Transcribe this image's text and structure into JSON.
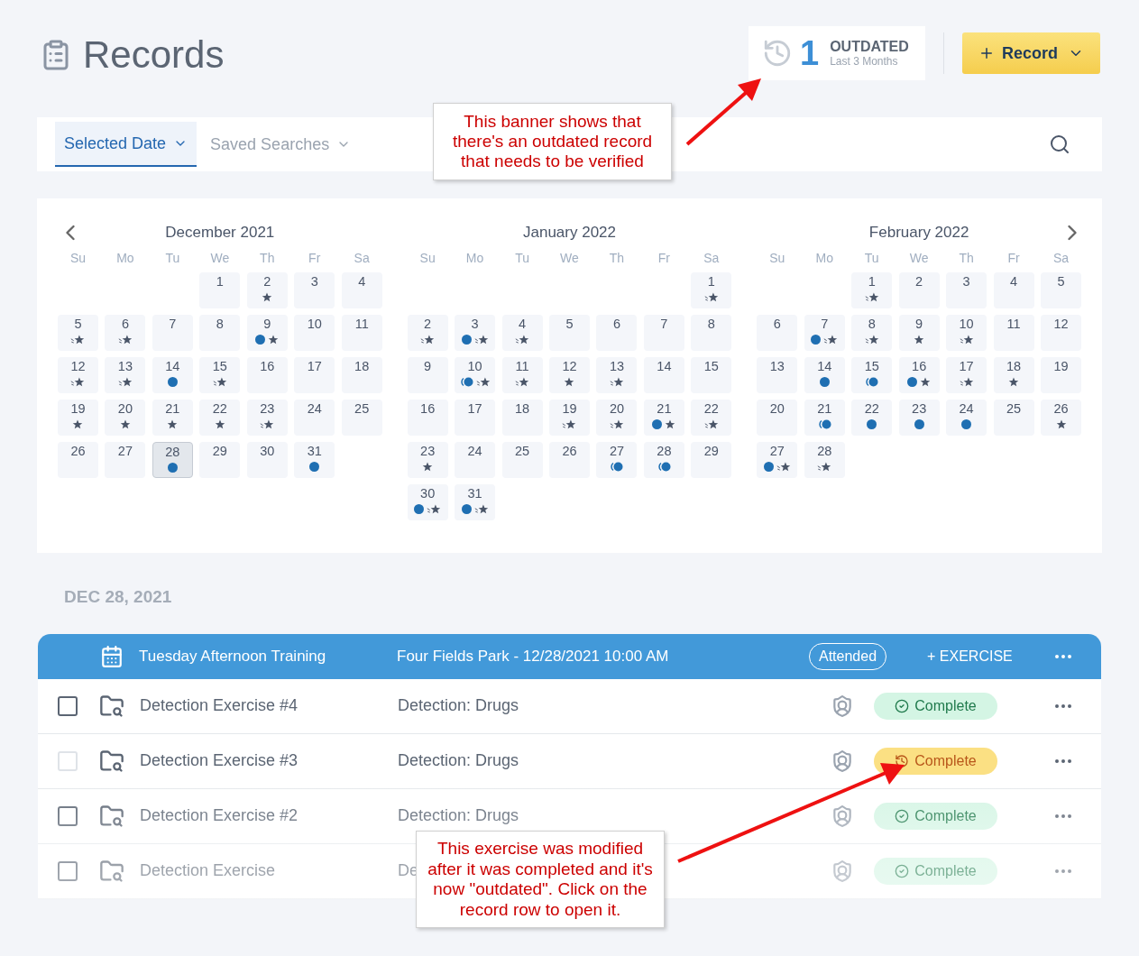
{
  "page": {
    "title": "Records"
  },
  "outdated_banner": {
    "count": "1",
    "label": "OUTDATED",
    "sublabel": "Last 3 Months"
  },
  "record_button": {
    "label": "Record"
  },
  "filter_tabs": [
    {
      "label": "Selected Date",
      "selected": true
    },
    {
      "label": "Saved Searches",
      "selected": false
    }
  ],
  "calendar": {
    "months": [
      {
        "title": "December 2021",
        "weekdays": [
          "Su",
          "Mo",
          "Tu",
          "We",
          "Th",
          "Fr",
          "Sa"
        ],
        "days": [
          {
            "kind": "blank"
          },
          {
            "kind": "blank"
          },
          {
            "kind": "blank"
          },
          {
            "kind": "day",
            "day": "1",
            "selected": false
          },
          {
            "kind": "day",
            "day": "2",
            "selected": false,
            "marks": [
              {
                "kind": "star"
              }
            ]
          },
          {
            "kind": "day",
            "day": "3",
            "selected": false
          },
          {
            "kind": "day",
            "day": "4",
            "selected": false
          },
          {
            "kind": "day",
            "day": "5",
            "selected": false,
            "marks": [
              {
                "kind": "star-trail"
              }
            ]
          },
          {
            "kind": "day",
            "day": "6",
            "selected": false,
            "marks": [
              {
                "kind": "star-trail"
              }
            ]
          },
          {
            "kind": "day",
            "day": "7",
            "selected": false
          },
          {
            "kind": "day",
            "day": "8",
            "selected": false
          },
          {
            "kind": "day",
            "day": "9",
            "selected": false,
            "marks": [
              {
                "kind": "dot"
              },
              {
                "kind": "star"
              }
            ]
          },
          {
            "kind": "day",
            "day": "10",
            "selected": false
          },
          {
            "kind": "day",
            "day": "11",
            "selected": false
          },
          {
            "kind": "day",
            "day": "12",
            "selected": false,
            "marks": [
              {
                "kind": "star-trail"
              }
            ]
          },
          {
            "kind": "day",
            "day": "13",
            "selected": false,
            "marks": [
              {
                "kind": "star-trail"
              }
            ]
          },
          {
            "kind": "day",
            "day": "14",
            "selected": false,
            "marks": [
              {
                "kind": "dot"
              }
            ]
          },
          {
            "kind": "day",
            "day": "15",
            "selected": false,
            "marks": [
              {
                "kind": "star-trail"
              }
            ]
          },
          {
            "kind": "day",
            "day": "16",
            "selected": false
          },
          {
            "kind": "day",
            "day": "17",
            "selected": false
          },
          {
            "kind": "day",
            "day": "18",
            "selected": false
          },
          {
            "kind": "day",
            "day": "19",
            "selected": false,
            "marks": [
              {
                "kind": "star"
              }
            ]
          },
          {
            "kind": "day",
            "day": "20",
            "selected": false,
            "marks": [
              {
                "kind": "star"
              }
            ]
          },
          {
            "kind": "day",
            "day": "21",
            "selected": false,
            "marks": [
              {
                "kind": "star"
              }
            ]
          },
          {
            "kind": "day",
            "day": "22",
            "selected": false,
            "marks": [
              {
                "kind": "star"
              }
            ]
          },
          {
            "kind": "day",
            "day": "23",
            "selected": false,
            "marks": [
              {
                "kind": "star-trail"
              }
            ]
          },
          {
            "kind": "day",
            "day": "24",
            "selected": false
          },
          {
            "kind": "day",
            "day": "25",
            "selected": false
          },
          {
            "kind": "day",
            "day": "26",
            "selected": false
          },
          {
            "kind": "day",
            "day": "27",
            "selected": false
          },
          {
            "kind": "day",
            "day": "28",
            "selected": true,
            "marks": [
              {
                "kind": "dot"
              }
            ]
          },
          {
            "kind": "day",
            "day": "29",
            "selected": false
          },
          {
            "kind": "day",
            "day": "30",
            "selected": false
          },
          {
            "kind": "day",
            "day": "31",
            "selected": false,
            "marks": [
              {
                "kind": "dot"
              }
            ]
          }
        ]
      },
      {
        "title": "January 2022",
        "weekdays": [
          "Su",
          "Mo",
          "Tu",
          "We",
          "Th",
          "Fr",
          "Sa"
        ],
        "days": [
          {
            "kind": "blank"
          },
          {
            "kind": "blank"
          },
          {
            "kind": "blank"
          },
          {
            "kind": "blank"
          },
          {
            "kind": "blank"
          },
          {
            "kind": "blank"
          },
          {
            "kind": "day",
            "day": "1",
            "selected": false,
            "marks": [
              {
                "kind": "star-trail"
              }
            ]
          },
          {
            "kind": "day",
            "day": "2",
            "selected": false,
            "marks": [
              {
                "kind": "star-trail"
              }
            ]
          },
          {
            "kind": "day",
            "day": "3",
            "selected": false,
            "marks": [
              {
                "kind": "dot"
              },
              {
                "kind": "star-trail"
              }
            ]
          },
          {
            "kind": "day",
            "day": "4",
            "selected": false,
            "marks": [
              {
                "kind": "star-trail"
              }
            ]
          },
          {
            "kind": "day",
            "day": "5",
            "selected": false
          },
          {
            "kind": "day",
            "day": "6",
            "selected": false
          },
          {
            "kind": "day",
            "day": "7",
            "selected": false
          },
          {
            "kind": "day",
            "day": "8",
            "selected": false
          },
          {
            "kind": "day",
            "day": "9",
            "selected": false
          },
          {
            "kind": "day",
            "day": "10",
            "selected": false,
            "marks": [
              {
                "kind": "dot-trail"
              },
              {
                "kind": "star-trail"
              }
            ]
          },
          {
            "kind": "day",
            "day": "11",
            "selected": false,
            "marks": [
              {
                "kind": "star-trail"
              }
            ]
          },
          {
            "kind": "day",
            "day": "12",
            "selected": false,
            "marks": [
              {
                "kind": "star"
              }
            ]
          },
          {
            "kind": "day",
            "day": "13",
            "selected": false,
            "marks": [
              {
                "kind": "star-trail"
              }
            ]
          },
          {
            "kind": "day",
            "day": "14",
            "selected": false
          },
          {
            "kind": "day",
            "day": "15",
            "selected": false
          },
          {
            "kind": "day",
            "day": "16",
            "selected": false
          },
          {
            "kind": "day",
            "day": "17",
            "selected": false
          },
          {
            "kind": "day",
            "day": "18",
            "selected": false
          },
          {
            "kind": "day",
            "day": "19",
            "selected": false,
            "marks": [
              {
                "kind": "star-trail"
              }
            ]
          },
          {
            "kind": "day",
            "day": "20",
            "selected": false,
            "marks": [
              {
                "kind": "star-trail"
              }
            ]
          },
          {
            "kind": "day",
            "day": "21",
            "selected": false,
            "marks": [
              {
                "kind": "dot"
              },
              {
                "kind": "star"
              }
            ]
          },
          {
            "kind": "day",
            "day": "22",
            "selected": false,
            "marks": [
              {
                "kind": "star-trail"
              }
            ]
          },
          {
            "kind": "day",
            "day": "23",
            "selected": false,
            "marks": [
              {
                "kind": "star"
              }
            ]
          },
          {
            "kind": "day",
            "day": "24",
            "selected": false
          },
          {
            "kind": "day",
            "day": "25",
            "selected": false
          },
          {
            "kind": "day",
            "day": "26",
            "selected": false
          },
          {
            "kind": "day",
            "day": "27",
            "selected": false,
            "marks": [
              {
                "kind": "dot-trail"
              }
            ]
          },
          {
            "kind": "day",
            "day": "28",
            "selected": false,
            "marks": [
              {
                "kind": "dot-trail"
              }
            ]
          },
          {
            "kind": "day",
            "day": "29",
            "selected": false
          },
          {
            "kind": "day",
            "day": "30",
            "selected": false,
            "marks": [
              {
                "kind": "dot"
              },
              {
                "kind": "star-trail"
              }
            ]
          },
          {
            "kind": "day",
            "day": "31",
            "selected": false,
            "marks": [
              {
                "kind": "dot"
              },
              {
                "kind": "star-trail"
              }
            ]
          }
        ]
      },
      {
        "title": "February 2022",
        "weekdays": [
          "Su",
          "Mo",
          "Tu",
          "We",
          "Th",
          "Fr",
          "Sa"
        ],
        "days": [
          {
            "kind": "blank"
          },
          {
            "kind": "blank"
          },
          {
            "kind": "day",
            "day": "1",
            "selected": false,
            "marks": [
              {
                "kind": "star-trail"
              }
            ]
          },
          {
            "kind": "day",
            "day": "2",
            "selected": false
          },
          {
            "kind": "day",
            "day": "3",
            "selected": false
          },
          {
            "kind": "day",
            "day": "4",
            "selected": false
          },
          {
            "kind": "day",
            "day": "5",
            "selected": false
          },
          {
            "kind": "day",
            "day": "6",
            "selected": false
          },
          {
            "kind": "day",
            "day": "7",
            "selected": false,
            "marks": [
              {
                "kind": "dot"
              },
              {
                "kind": "star-trail"
              }
            ]
          },
          {
            "kind": "day",
            "day": "8",
            "selected": false,
            "marks": [
              {
                "kind": "star-trail"
              }
            ]
          },
          {
            "kind": "day",
            "day": "9",
            "selected": false,
            "marks": [
              {
                "kind": "star"
              }
            ]
          },
          {
            "kind": "day",
            "day": "10",
            "selected": false,
            "marks": [
              {
                "kind": "star-trail"
              }
            ]
          },
          {
            "kind": "day",
            "day": "11",
            "selected": false
          },
          {
            "kind": "day",
            "day": "12",
            "selected": false
          },
          {
            "kind": "day",
            "day": "13",
            "selected": false
          },
          {
            "kind": "day",
            "day": "14",
            "selected": false,
            "marks": [
              {
                "kind": "dot"
              }
            ]
          },
          {
            "kind": "day",
            "day": "15",
            "selected": false,
            "marks": [
              {
                "kind": "dot-trail"
              }
            ]
          },
          {
            "kind": "day",
            "day": "16",
            "selected": false,
            "marks": [
              {
                "kind": "dot"
              },
              {
                "kind": "star"
              }
            ]
          },
          {
            "kind": "day",
            "day": "17",
            "selected": false,
            "marks": [
              {
                "kind": "star-trail"
              }
            ]
          },
          {
            "kind": "day",
            "day": "18",
            "selected": false,
            "marks": [
              {
                "kind": "star"
              }
            ]
          },
          {
            "kind": "day",
            "day": "19",
            "selected": false
          },
          {
            "kind": "day",
            "day": "20",
            "selected": false
          },
          {
            "kind": "day",
            "day": "21",
            "selected": false,
            "marks": [
              {
                "kind": "dot-trail"
              }
            ]
          },
          {
            "kind": "day",
            "day": "22",
            "selected": false,
            "marks": [
              {
                "kind": "dot"
              }
            ]
          },
          {
            "kind": "day",
            "day": "23",
            "selected": false,
            "marks": [
              {
                "kind": "dot"
              }
            ]
          },
          {
            "kind": "day",
            "day": "24",
            "selected": false,
            "marks": [
              {
                "kind": "dot"
              }
            ]
          },
          {
            "kind": "day",
            "day": "25",
            "selected": false
          },
          {
            "kind": "day",
            "day": "26",
            "selected": false,
            "marks": [
              {
                "kind": "star"
              }
            ]
          },
          {
            "kind": "day",
            "day": "27",
            "selected": false,
            "marks": [
              {
                "kind": "dot"
              },
              {
                "kind": "star-trail"
              }
            ]
          },
          {
            "kind": "day",
            "day": "28",
            "selected": false,
            "marks": [
              {
                "kind": "star-trail"
              }
            ]
          }
        ]
      }
    ]
  },
  "date_heading": "DEC 28, 2021",
  "session": {
    "title": "Tuesday Afternoon Training",
    "details": "Four Fields Park - 12/28/2021 10:00 AM",
    "badge": "Attended",
    "add_label": "+ EXERCISE"
  },
  "rows": [
    {
      "name": "Detection Exercise #4",
      "category": "Detection: Drugs",
      "checked": false,
      "disabled": false,
      "status": {
        "kind": "complete",
        "label": "Complete"
      }
    },
    {
      "name": "Detection Exercise #3",
      "category": "Detection: Drugs",
      "checked": false,
      "disabled": true,
      "status": {
        "kind": "outdated",
        "label": "Complete"
      }
    },
    {
      "name": "Detection Exercise #2",
      "category": "Detection: Drugs",
      "checked": false,
      "disabled": false,
      "status": {
        "kind": "complete",
        "label": "Complete"
      }
    },
    {
      "name": "Detection Exercise",
      "category": "De",
      "checked": false,
      "disabled": false,
      "status": {
        "kind": "complete",
        "label": "Complete"
      }
    }
  ],
  "callouts": [
    "This banner shows that there's an outdated record that needs to be verified",
    "This exercise was modified after it was completed and it's now \"outdated\". Click on the record row to open it."
  ]
}
